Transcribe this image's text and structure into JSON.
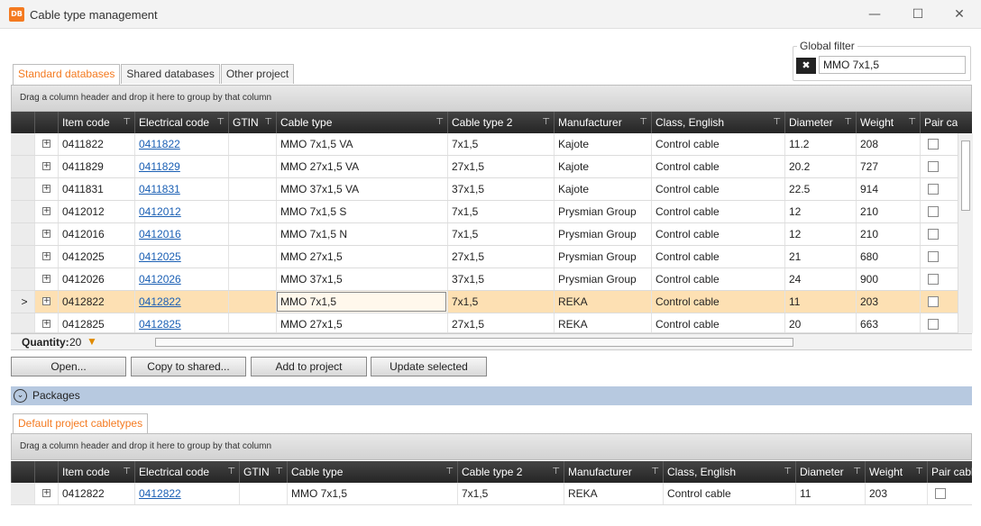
{
  "window": {
    "app_icon_text": "DB",
    "title": "Cable type management",
    "minimize_glyph": "—",
    "maximize_glyph": "☐",
    "close_glyph": "✕"
  },
  "tabs": [
    {
      "label": "Standard databases",
      "active": true
    },
    {
      "label": "Shared databases",
      "active": false
    },
    {
      "label": "Other project",
      "active": false
    }
  ],
  "global_filter": {
    "label": "Global filter",
    "value": "MMO 7x1,5",
    "icon": "clear-filter-icon"
  },
  "group_hint": "Drag a column header and drop it here to group by that column",
  "columns": [
    "Item code",
    "Electrical code",
    "GTIN",
    "Cable type",
    "Cable type 2",
    "Manufacturer",
    "Class, English",
    "Diameter",
    "Weight",
    "Pair cables"
  ],
  "columns_bottom": [
    "Item code",
    "Electrical code",
    "GTIN",
    "Cable type",
    "Cable type 2",
    "Manufacturer",
    "Class, English",
    "Diameter",
    "Weight",
    "Pair cables"
  ],
  "filter_glyph": "⊤",
  "expand_glyph": "+",
  "rows": [
    {
      "item_code": "0411822",
      "electrical_code": "0411822",
      "gtin": "",
      "cable_type": "MMO 7x1,5 VA",
      "cable_type_2": "7x1,5",
      "manufacturer": "Kajote",
      "class_english": "Control cable",
      "diameter": "11.2",
      "weight": "208",
      "pair_cables": false,
      "selected": false
    },
    {
      "item_code": "0411829",
      "electrical_code": "0411829",
      "gtin": "",
      "cable_type": "MMO 27x1,5 VA",
      "cable_type_2": "27x1,5",
      "manufacturer": "Kajote",
      "class_english": "Control cable",
      "diameter": "20.2",
      "weight": "727",
      "pair_cables": false,
      "selected": false
    },
    {
      "item_code": "0411831",
      "electrical_code": "0411831",
      "gtin": "",
      "cable_type": "MMO 37x1,5 VA",
      "cable_type_2": "37x1,5",
      "manufacturer": "Kajote",
      "class_english": "Control cable",
      "diameter": "22.5",
      "weight": "914",
      "pair_cables": false,
      "selected": false
    },
    {
      "item_code": "0412012",
      "electrical_code": "0412012",
      "gtin": "",
      "cable_type": "MMO 7x1,5 S",
      "cable_type_2": "7x1,5",
      "manufacturer": "Prysmian Group",
      "class_english": "Control cable",
      "diameter": "12",
      "weight": "210",
      "pair_cables": false,
      "selected": false
    },
    {
      "item_code": "0412016",
      "electrical_code": "0412016",
      "gtin": "",
      "cable_type": "MMO 7x1,5 N",
      "cable_type_2": "7x1,5",
      "manufacturer": "Prysmian Group",
      "class_english": "Control cable",
      "diameter": "12",
      "weight": "210",
      "pair_cables": false,
      "selected": false
    },
    {
      "item_code": "0412025",
      "electrical_code": "0412025",
      "gtin": "",
      "cable_type": "MMO 27x1,5",
      "cable_type_2": "27x1,5",
      "manufacturer": "Prysmian Group",
      "class_english": "Control cable",
      "diameter": "21",
      "weight": "680",
      "pair_cables": false,
      "selected": false
    },
    {
      "item_code": "0412026",
      "electrical_code": "0412026",
      "gtin": "",
      "cable_type": "MMO 37x1,5",
      "cable_type_2": "37x1,5",
      "manufacturer": "Prysmian Group",
      "class_english": "Control cable",
      "diameter": "24",
      "weight": "900",
      "pair_cables": false,
      "selected": false
    },
    {
      "item_code": "0412822",
      "electrical_code": "0412822",
      "gtin": "",
      "cable_type": "MMO 7x1,5",
      "cable_type_2": "7x1,5",
      "manufacturer": "REKA",
      "class_english": "Control cable",
      "diameter": "11",
      "weight": "203",
      "pair_cables": false,
      "selected": true
    },
    {
      "item_code": "0412825",
      "electrical_code": "0412825",
      "gtin": "",
      "cable_type": "MMO 27x1,5",
      "cable_type_2": "27x1,5",
      "manufacturer": "REKA",
      "class_english": "Control cable",
      "diameter": "20",
      "weight": "663",
      "pair_cables": false,
      "selected": false
    }
  ],
  "row_indicator": ">",
  "status": {
    "quantity_label": "Quantity:",
    "quantity_value": "20"
  },
  "buttons": {
    "open": "Open...",
    "copy_to_shared": "Copy to shared...",
    "add_to_project": "Add to project",
    "update_selected": "Update selected"
  },
  "packages": {
    "label": "Packages",
    "expand_glyph": "⌄"
  },
  "bottom_tab": "Default project cabletypes",
  "bottom_rows": [
    {
      "item_code": "0412822",
      "electrical_code": "0412822",
      "gtin": "",
      "cable_type": "MMO 7x1,5",
      "cable_type_2": "7x1,5",
      "manufacturer": "REKA",
      "class_english": "Control cable",
      "diameter": "11",
      "weight": "203",
      "pair_cables": false
    }
  ]
}
